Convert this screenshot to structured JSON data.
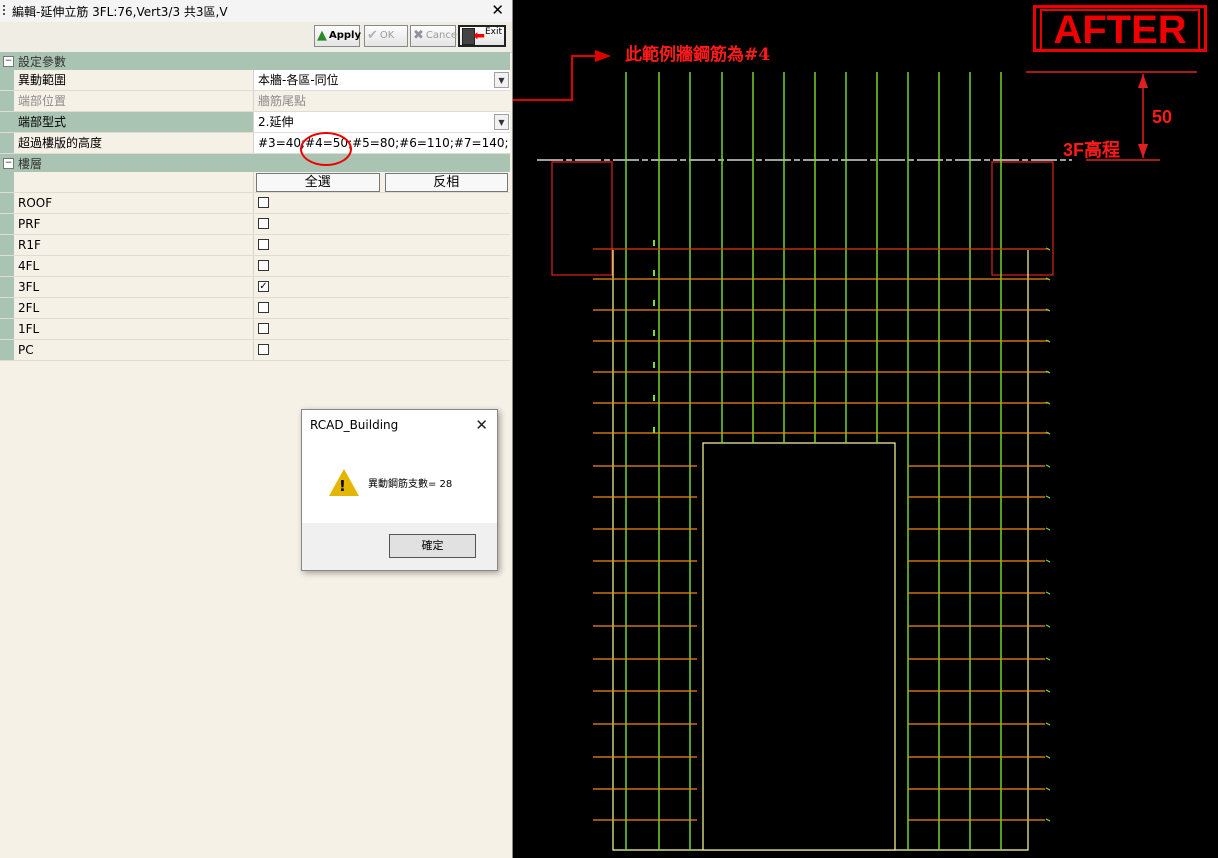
{
  "window": {
    "title": "編輯-延伸立筋 3FL:76,Vert3/3 共3區,V",
    "close": "✕"
  },
  "toolbar": {
    "apply_label": "Apply",
    "ok_label": "OK",
    "cancel_label": "Cancel",
    "exit_label": "Exit"
  },
  "settings": {
    "category": "設定參數",
    "rows": [
      {
        "label": "異動範圍",
        "value": "本牆-各區-同位"
      },
      {
        "label": "端部位置",
        "value": "牆筋尾點"
      },
      {
        "label": "端部型式",
        "value": "2.延伸"
      },
      {
        "label": "超過樓版的高度",
        "value": "#3=40;#4=50;#5=80;#6=110;#7=140;"
      }
    ]
  },
  "floors": {
    "category": "樓層",
    "select_all_label": "全選",
    "invert_label": "反相",
    "items": [
      {
        "name": "ROOF",
        "checked": false
      },
      {
        "name": "PRF",
        "checked": false
      },
      {
        "name": "R1F",
        "checked": false
      },
      {
        "name": "4FL",
        "checked": false
      },
      {
        "name": "3FL",
        "checked": true
      },
      {
        "name": "2FL",
        "checked": false
      },
      {
        "name": "1FL",
        "checked": false
      },
      {
        "name": "PC",
        "checked": false
      }
    ]
  },
  "dialog": {
    "title": "RCAD_Building",
    "close": "✕",
    "message": "異動鋼筋支數= 28",
    "ok_label": "確定"
  },
  "cad": {
    "after_label": "AFTER",
    "note": "此範例牆鋼筋為#4",
    "dimension_value": "50",
    "level_label": "3F高程"
  },
  "colors": {
    "accent_red": "#ff1a1a",
    "rebar_green": "#7fe02a",
    "rebar_orange": "#f08a1c",
    "outline_yellow": "#ffff9a",
    "category_green": "#a9c4b3"
  }
}
